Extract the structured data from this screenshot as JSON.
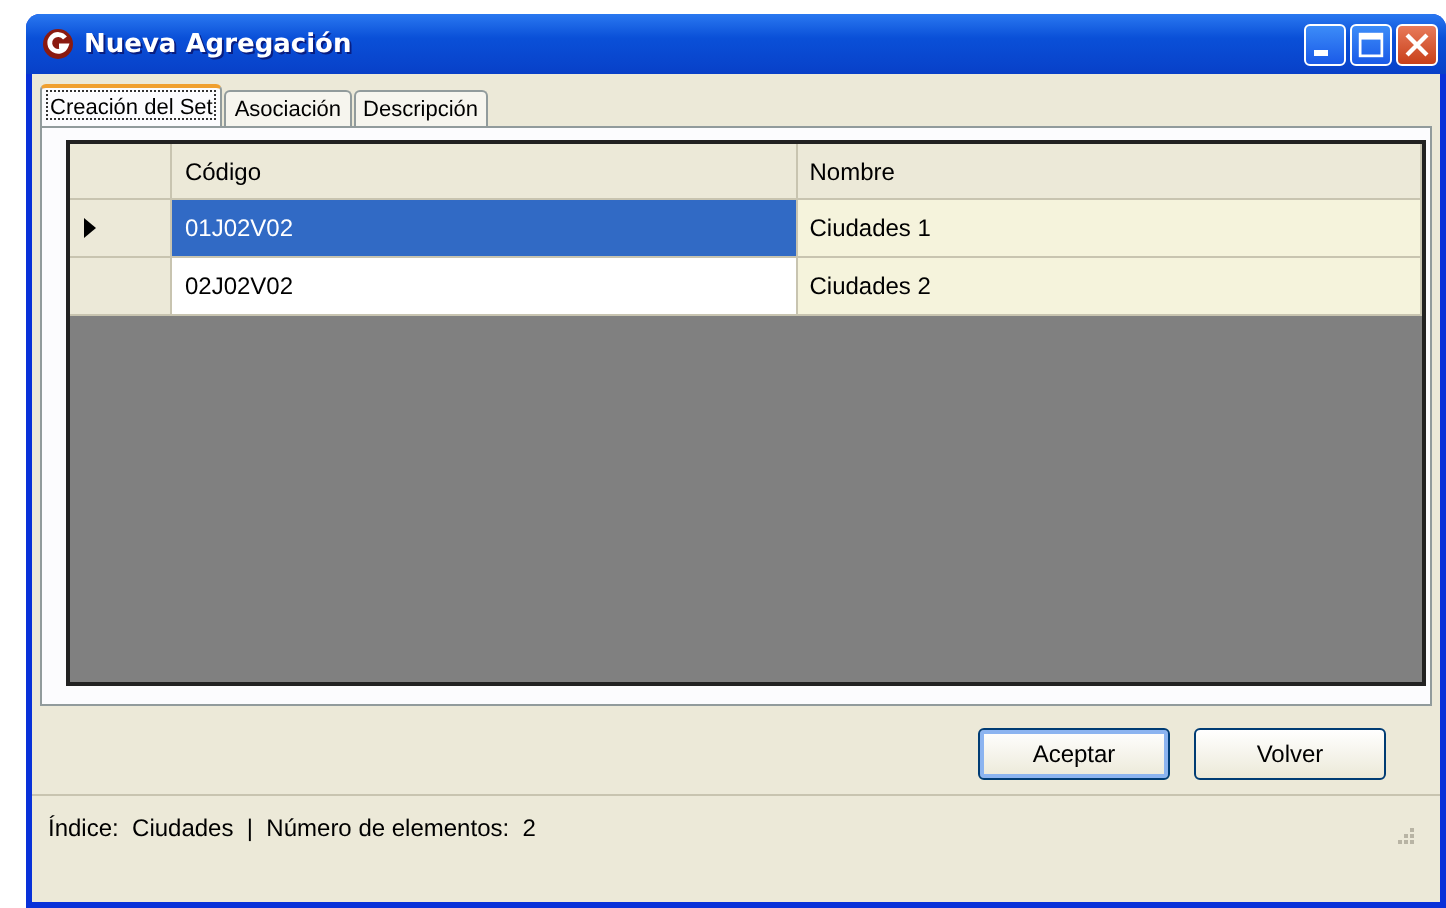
{
  "window": {
    "title": "Nueva Agregación"
  },
  "tabs": [
    {
      "label": "Creación del Set",
      "selected": true
    },
    {
      "label": "Asociación",
      "selected": false
    },
    {
      "label": "Descripción",
      "selected": false
    }
  ],
  "table": {
    "columns": [
      "Código",
      "Nombre"
    ],
    "rows": [
      {
        "cells": [
          "01J02V02",
          "Ciudades 1"
        ],
        "selected": true
      },
      {
        "cells": [
          "02J02V02",
          "Ciudades 2"
        ],
        "selected": false
      }
    ]
  },
  "buttons": [
    "Aceptar",
    "Volver"
  ],
  "status_bar": {
    "text": "Índice:  Ciudades  |  Número de elementos:  2"
  }
}
